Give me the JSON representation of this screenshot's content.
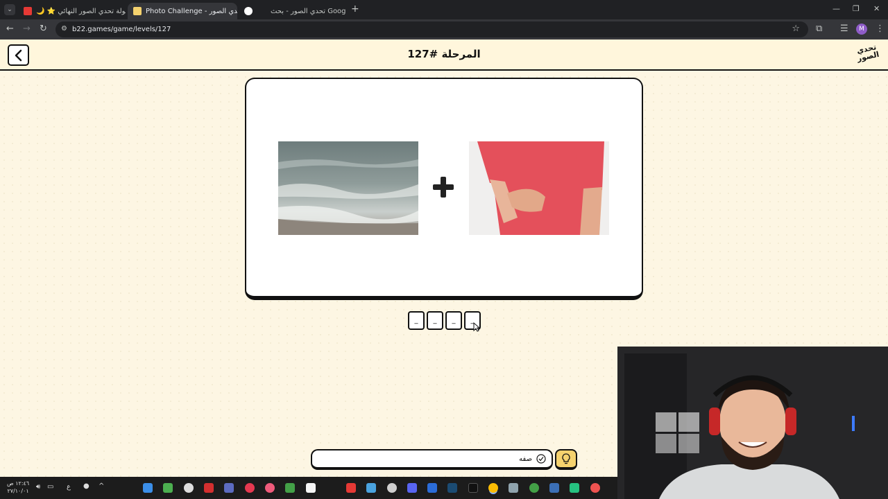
{
  "browser": {
    "tabs": [
      {
        "label": "بطولة تحدي الصور النهائي ⭐ 🌙",
        "active": false
      },
      {
        "label": "Photo Challenge - تحدي الصور",
        "active": true
      },
      {
        "label": "تحدي الصور - بحث Google",
        "active": false
      }
    ],
    "new_tab": "+",
    "url": "b22.games/game/levels/127",
    "profile_initial": "M"
  },
  "game": {
    "level_title": "المرحلة #127",
    "logo_text": "تحدي الصور",
    "images": [
      {
        "subject": "sea waves on beach"
      },
      {
        "subject": "person scratching arm"
      }
    ],
    "operator": "+",
    "answer_slots": [
      "_",
      "_",
      "_",
      "_"
    ],
    "answer_button_text": "صفه",
    "colors": {
      "background": "#fdf6e3",
      "hint_button": "#f5d26e",
      "border": "#111111"
    }
  },
  "taskbar": {
    "time": "١٢:٤٦ ص",
    "date": "٢٧/١٠/٠١",
    "lang": "ع"
  }
}
